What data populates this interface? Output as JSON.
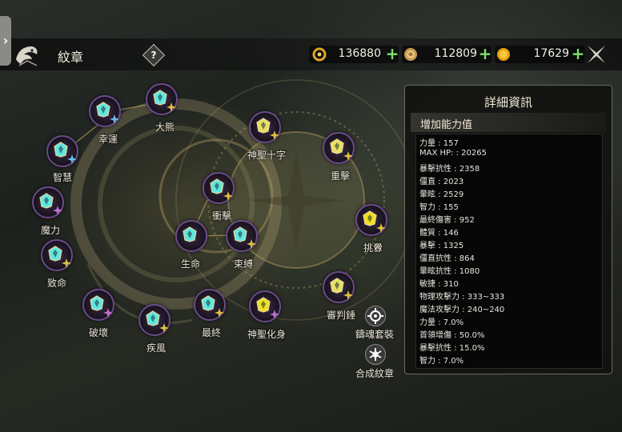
{
  "header": {
    "title": "紋章",
    "help_label": "?",
    "currencies": [
      {
        "name": "crystal",
        "value": "136880",
        "color": "#e0a820"
      },
      {
        "name": "soul-coin",
        "value": "112809",
        "color": "#c89a50"
      },
      {
        "name": "gold",
        "value": "17629",
        "color": "#e8a010"
      }
    ],
    "plus_label": "+"
  },
  "nodes": [
    {
      "id": "great-bear",
      "label": "大熊",
      "gem": "#5fe8e0",
      "badge": "#e0c040"
    },
    {
      "id": "luck",
      "label": "幸運",
      "gem": "#5fe8e0",
      "badge": "#70b8e8"
    },
    {
      "id": "wisdom",
      "label": "智慧",
      "gem": "#5fe8e0",
      "badge": "#70b8e8"
    },
    {
      "id": "magic-power",
      "label": "魔力",
      "gem": "#5fe8e0",
      "badge": "#c070d0"
    },
    {
      "id": "fatal",
      "label": "致命",
      "gem": "#5fe8e0",
      "badge": "#e0c040"
    },
    {
      "id": "destroy",
      "label": "破壞",
      "gem": "#5fe8e0",
      "badge": "#c070d0"
    },
    {
      "id": "gale",
      "label": "疾風",
      "gem": "#5fe8e0",
      "badge": "#e0c040"
    },
    {
      "id": "final",
      "label": "最終",
      "gem": "#5fe8e0",
      "badge": "#e0c040"
    },
    {
      "id": "life",
      "label": "生命",
      "gem": "#5fe8e0",
      "badge": ""
    },
    {
      "id": "bind",
      "label": "束縛",
      "gem": "#5fe8e0",
      "badge": "#e0c040"
    },
    {
      "id": "impact",
      "label": "衝擊",
      "gem": "#5fe8e0",
      "badge": "#e0c040"
    },
    {
      "id": "holy-cross",
      "label": "神聖十字",
      "gem": "#e8e060",
      "badge": "#e0c040"
    },
    {
      "id": "heavy-strike",
      "label": "重擊",
      "gem": "#e8e060",
      "badge": "#e0c040"
    },
    {
      "id": "provoke",
      "label": "挑釁",
      "gem": "#f0e020",
      "badge": "#e0c040"
    },
    {
      "id": "judgement-hammer",
      "label": "審判錘",
      "gem": "#e8e060",
      "badge": "#e0c040"
    },
    {
      "id": "holy-avatar",
      "label": "神聖化身",
      "gem": "#f0e020",
      "badge": "#c070d0"
    }
  ],
  "side_buttons": [
    {
      "id": "forge-set",
      "label": "鑄魂套裝",
      "icon": "gear-icon"
    },
    {
      "id": "synthesize",
      "label": "合成紋章",
      "icon": "snowflake-icon"
    }
  ],
  "panel": {
    "title": "詳細資訊",
    "subtitle": "增加能力值",
    "stats": [
      "力量 : 157",
      "MAX HP:  : 20265",
      "暴擊抗性 : 2358",
      "僵直 : 2023",
      "暈眩 : 2529",
      "智力 : 155",
      "最終傷害 : 952",
      "體質 : 146",
      "暴擊 : 1325",
      "僵直抗性 : 864",
      "暈眩抗性 : 1080",
      "敏捷 : 310",
      "物理攻擊力 : 333~333",
      "魔法攻擊力 : 240~240",
      "力量 : 7.0%",
      "首領增傷 : 50.0%",
      "暴擊抗性 : 15.0%",
      "智力 : 7.0%"
    ]
  }
}
